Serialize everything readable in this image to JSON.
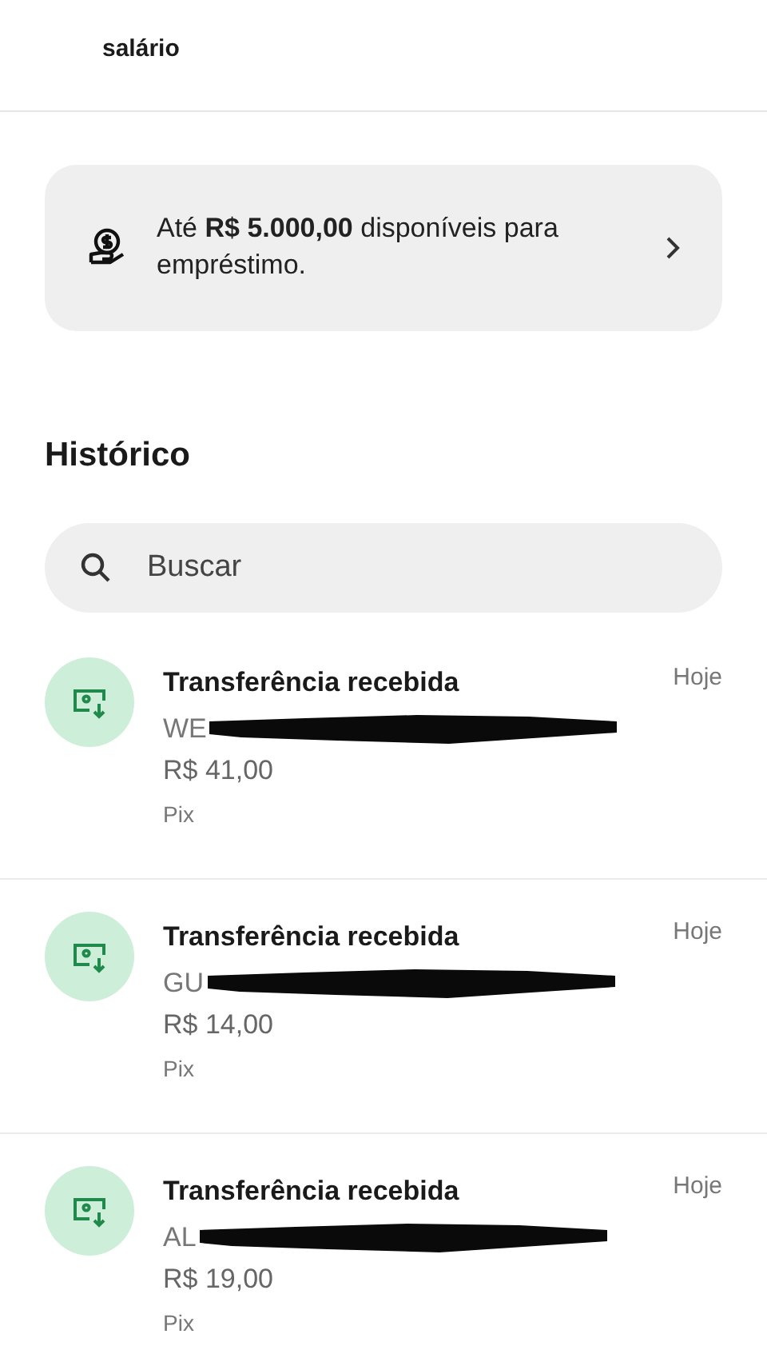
{
  "header": {
    "title": "salário"
  },
  "loan_banner": {
    "text": "Até **R$ 5.000,00** disponíveis para empréstimo."
  },
  "history": {
    "title": "Histórico",
    "search": {
      "placeholder": "Buscar"
    },
    "transactions": [
      {
        "title": "Transferência recebida",
        "name": "WE",
        "redacted": true,
        "amount": "R$ 41,00",
        "method": "Pix",
        "date": "Hoje"
      },
      {
        "title": "Transferência recebida",
        "name": "GU",
        "redacted": true,
        "amount": "R$ 14,00",
        "method": "Pix",
        "date": "Hoje"
      },
      {
        "title": "Transferência recebida",
        "name": "AL",
        "redacted": true,
        "amount": "R$ 19,00",
        "method": "Pix",
        "date": "Hoje"
      }
    ]
  }
}
